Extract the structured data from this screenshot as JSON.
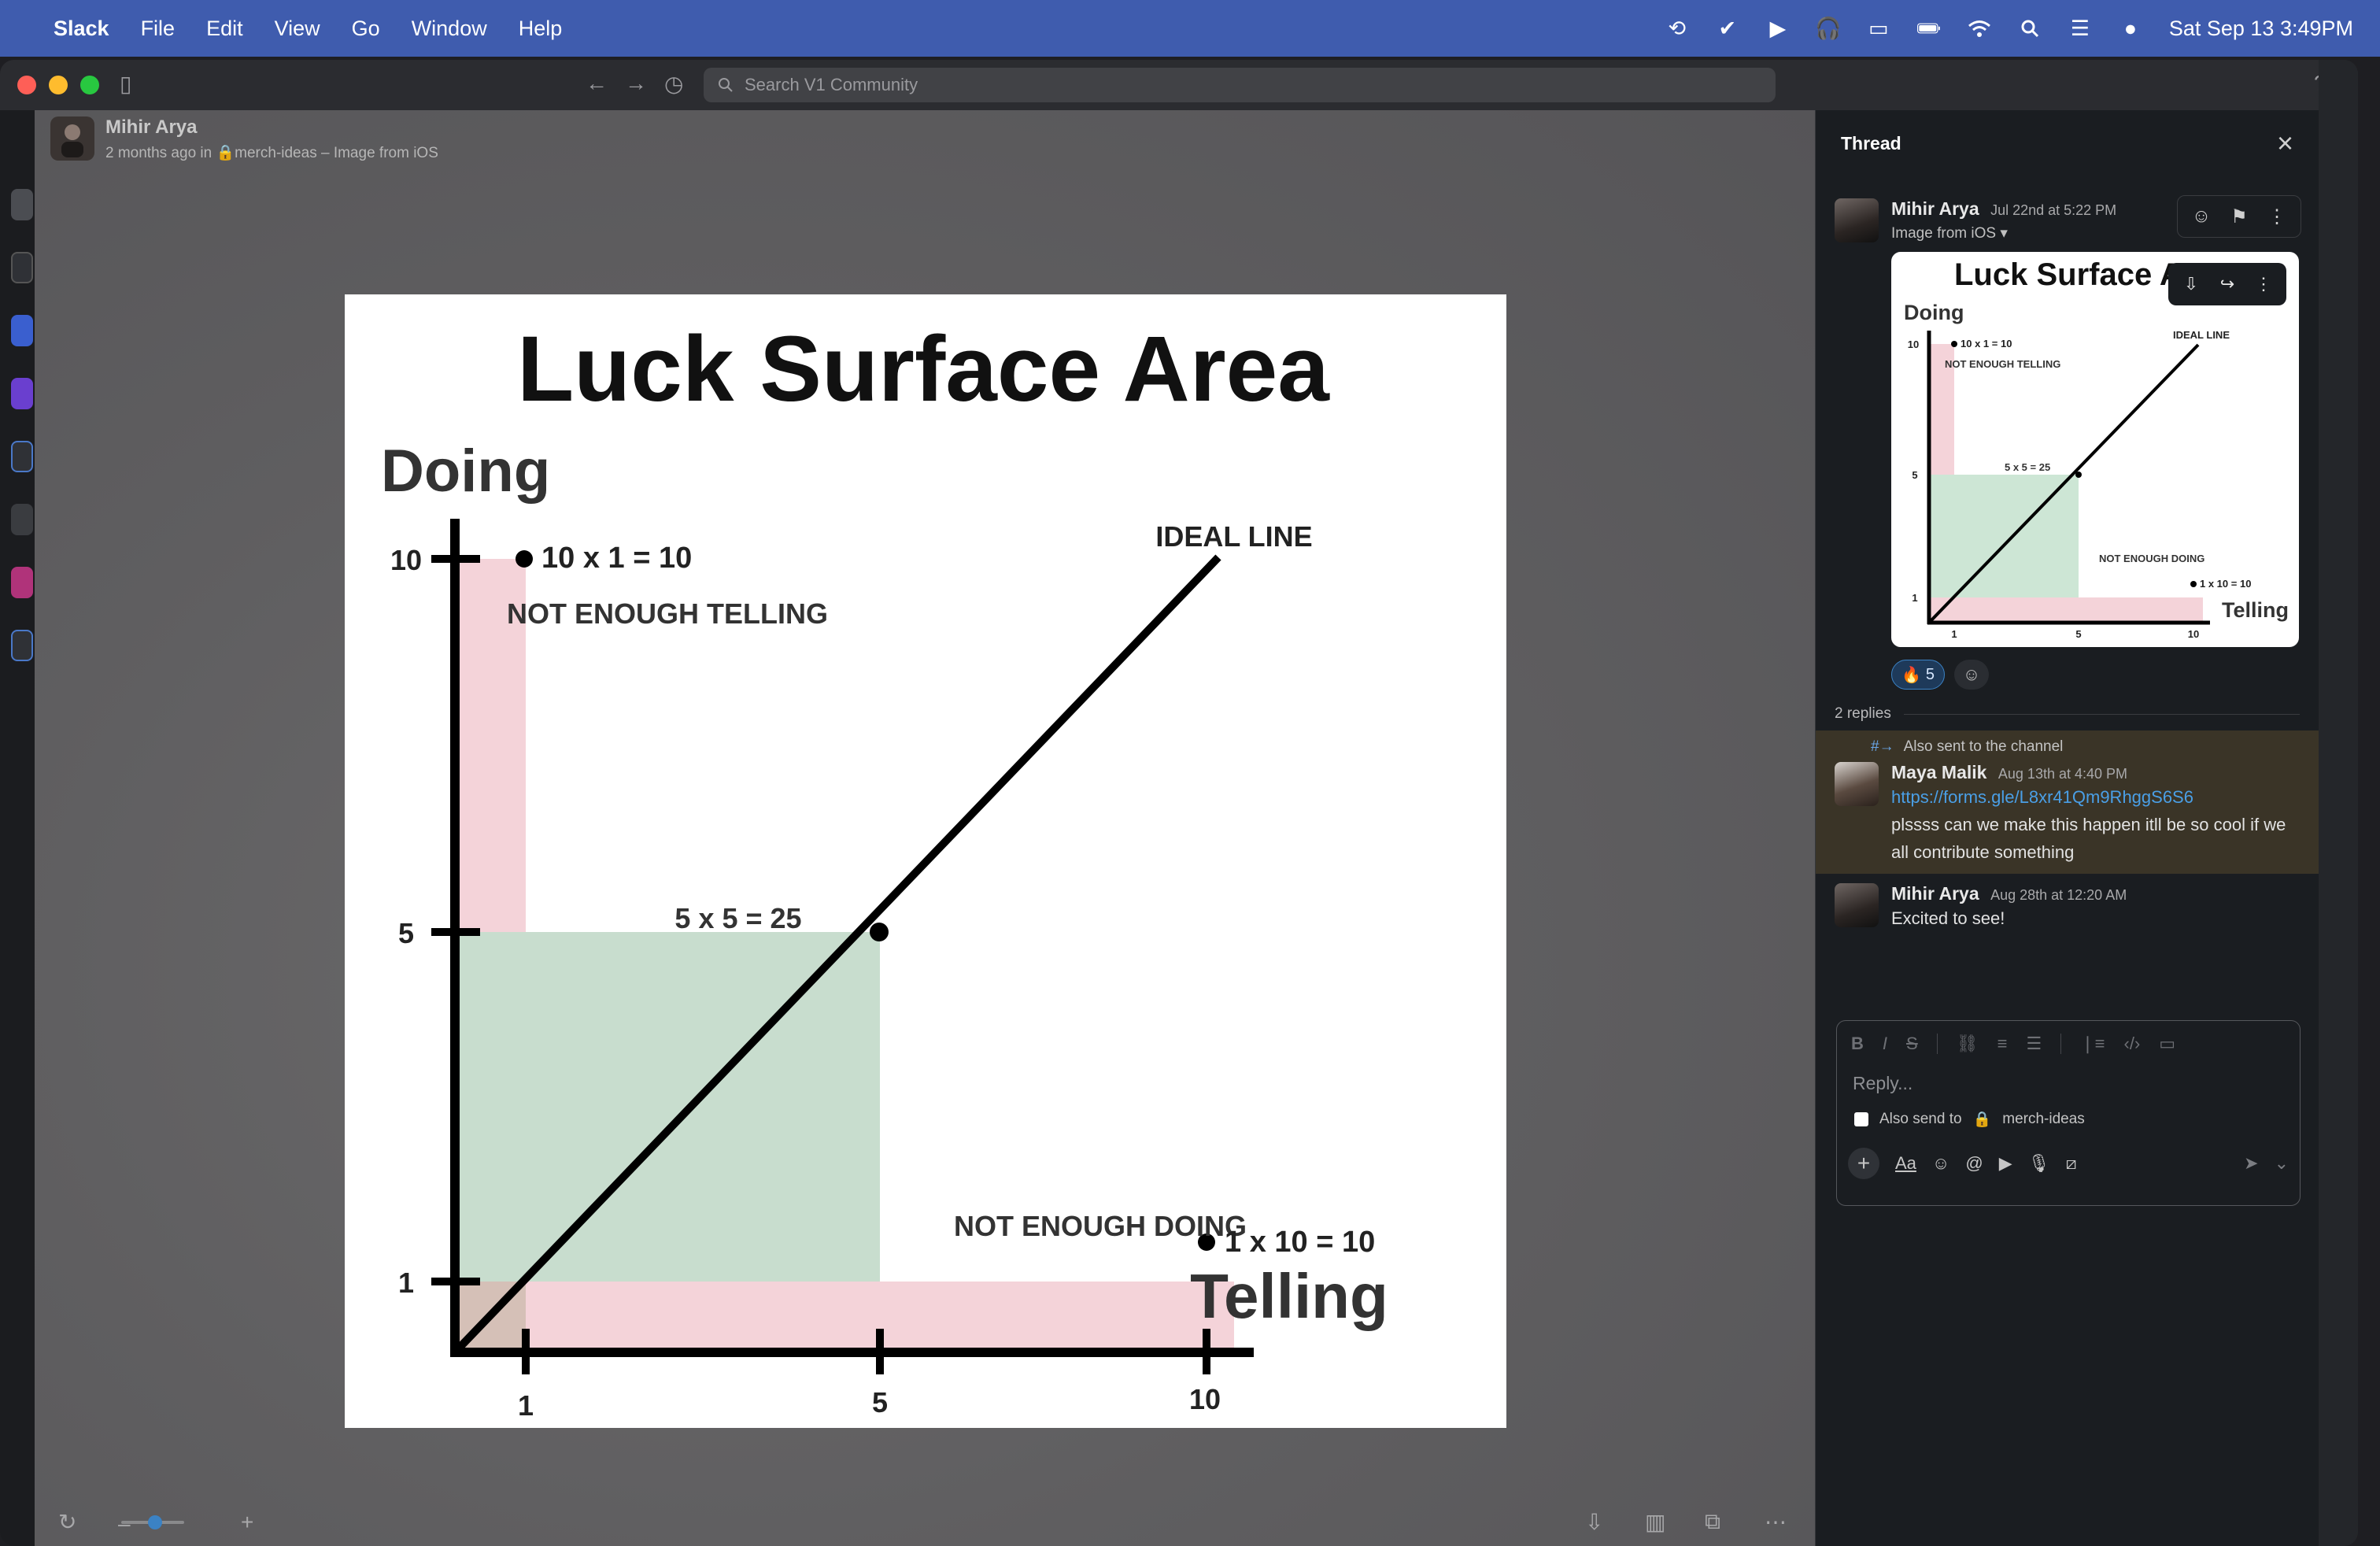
{
  "menubar": {
    "app_name": "Slack",
    "menus": [
      "File",
      "Edit",
      "View",
      "Go",
      "Window",
      "Help"
    ],
    "datetime": "Sat Sep 13  3:49PM"
  },
  "search": {
    "placeholder": "Search V1 Community"
  },
  "viewer": {
    "author": "Mihir Arya",
    "meta_prefix": "2 months ago in",
    "channel": "merch-ideas",
    "meta_suffix": "– Image from iOS"
  },
  "image_text": {
    "title": "Luck Surface Area",
    "y_axis": "Doing",
    "x_axis": "Telling",
    "ideal_line": "IDEAL LINE",
    "not_enough_telling": "NOT ENOUGH TELLING",
    "not_enough_doing": "NOT ENOUGH DOING",
    "point_top": "10 x 1 = 10",
    "point_mid": "5 x 5 = 25",
    "point_right": "1 x 10 = 10",
    "x_ticks": [
      "1",
      "5",
      "10"
    ],
    "y_ticks": [
      "10",
      "5",
      "1"
    ]
  },
  "thread": {
    "title": "Thread",
    "root": {
      "author": "Mihir Arya",
      "time": "Jul 22nd at 5:22 PM",
      "image_label": "Image from iOS",
      "reaction_emoji": "🔥",
      "reaction_count": "5"
    },
    "replies_count": "2 replies",
    "also_sent": "Also sent to the channel",
    "replies": [
      {
        "author": "Maya Malik",
        "time": "Aug 13th at 4:40 PM",
        "link": "https://forms.gle/L8xr41Qm9RhggS6S6",
        "text": "plssss can we make this happen itll be so cool if we all contribute something"
      },
      {
        "author": "Mihir Arya",
        "time": "Aug 28th at 12:20 AM",
        "text": "Excited to see!"
      }
    ]
  },
  "composer": {
    "placeholder": "Reply...",
    "also_send_label": "Also send to",
    "channel": "merch-ideas"
  },
  "colors": {
    "menubar": "#3f5cae",
    "pink_zone": "#f4d3d9",
    "green_zone": "#cde6d5",
    "link": "#4a9fe6"
  }
}
